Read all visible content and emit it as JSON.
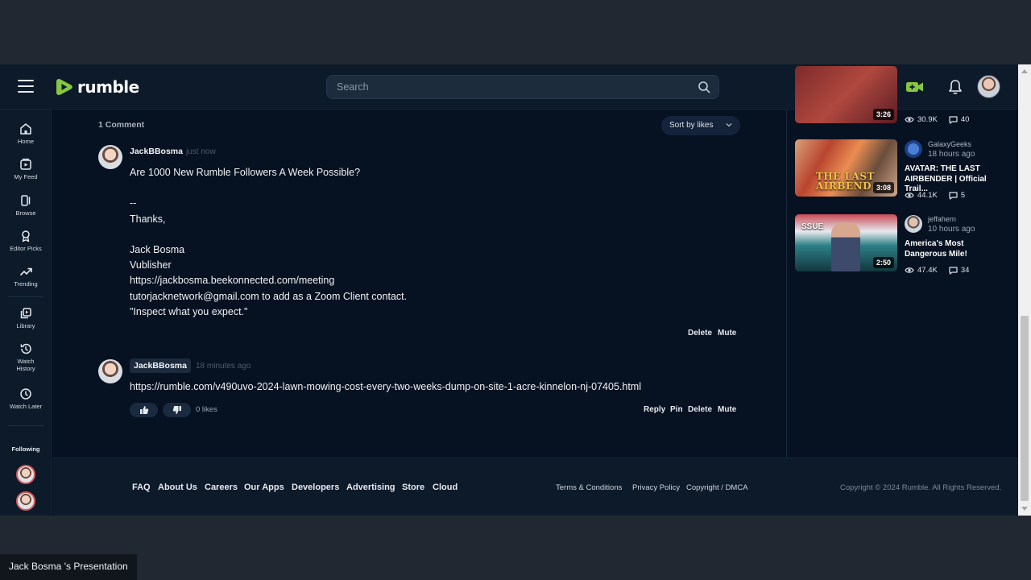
{
  "header": {
    "logo_text": "rumble",
    "search_placeholder": "Search",
    "icons": [
      "menu-icon",
      "search-icon",
      "go-live-icon",
      "bell-icon",
      "user-avatar"
    ]
  },
  "leftnav": {
    "items": [
      {
        "label": "Home",
        "icon": "home-icon"
      },
      {
        "label": "My Feed",
        "icon": "feed-icon"
      },
      {
        "label": "Browse",
        "icon": "browse-icon"
      },
      {
        "label": "Editor Picks",
        "icon": "award-icon"
      },
      {
        "label": "Trending",
        "icon": "trending-icon"
      },
      {
        "label": "Library",
        "icon": "library-icon"
      },
      {
        "label": "Watch History",
        "icon": "history-icon"
      },
      {
        "label": "Watch Later",
        "icon": "clock-icon"
      }
    ],
    "following_label": "Following"
  },
  "comments": {
    "count_label": "1 Comment",
    "sort_label": "Sort by likes",
    "items": [
      {
        "author": "JackBBosma",
        "time": "just now",
        "lines": [
          "Are 1000 New Rumble Followers A Week Possible?",
          "",
          "--",
          "Thanks,",
          "",
          "Jack Bosma",
          "Vublisher",
          "https://jackbosma.beekonnected.com/meeting",
          "tutorjacknetwork@gmail.com to add as a Zoom Client contact.",
          "\"Inspect what you expect.\""
        ],
        "actions": [
          "Delete",
          "Mute"
        ]
      },
      {
        "author": "JackBBosma",
        "time": "18 minutes ago",
        "lines": [
          "https://rumble.com/v490uvo-2024-lawn-mowing-cost-every-two-weeks-dump-on-site-1-acre-kinnelon-nj-07405.html"
        ],
        "likes": "0 likes",
        "actions": [
          "Reply",
          "Pin",
          "Delete",
          "Mute"
        ]
      }
    ]
  },
  "rail": {
    "partial": {
      "duration": "3:26",
      "views": "30.9K",
      "comments": "40"
    },
    "videos": [
      {
        "channel": "GalaxyGeeks",
        "time": "18 hours ago",
        "title": "AVATAR: THE LAST AIRBENDER | Official Trail...",
        "duration": "3:08",
        "views": "44.1K",
        "comments": "5",
        "thumb_text": "THE LAST AIRBEND"
      },
      {
        "channel": "jeffahern",
        "time": "10 hours ago",
        "title": "America's Most Dangerous Mile!",
        "duration": "2:50",
        "views": "47.4K",
        "comments": "34",
        "thumb_text": "SSUE"
      }
    ]
  },
  "footer": {
    "links": [
      "FAQ",
      "About Us",
      "Careers",
      "Our Apps",
      "Developers",
      "Advertising",
      "Store",
      "Cloud"
    ],
    "legal": [
      "Terms & Conditions",
      "Privacy Policy",
      "Copyright / DMCA"
    ],
    "copyright": "Copyright © 2024 Rumble. All Rights Reserved."
  },
  "presenter_label": "Jack Bosma 's Presentation",
  "colors": {
    "brand_green": "#85c742",
    "page_bg": "#061121",
    "panel_bg": "#0c1a2a"
  }
}
